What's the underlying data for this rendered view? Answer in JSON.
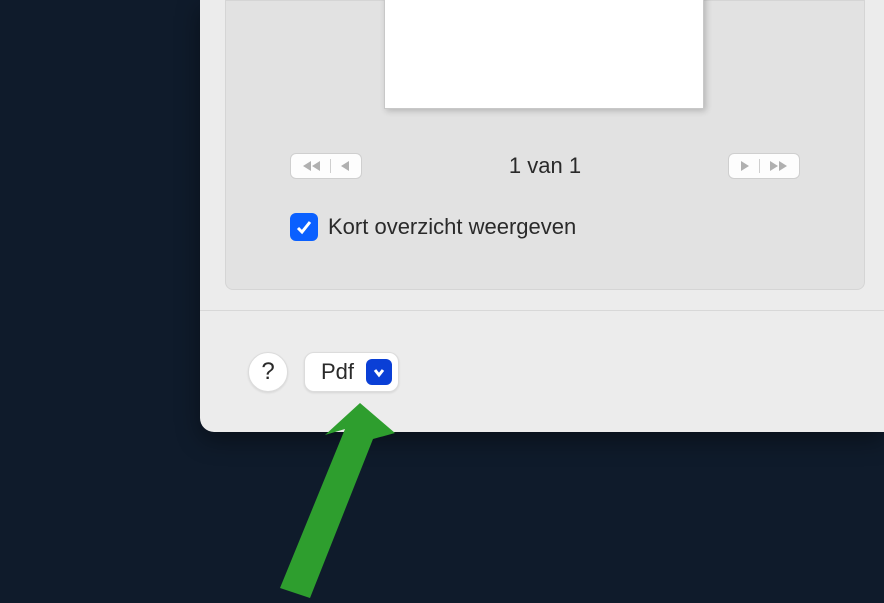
{
  "preview": {
    "page_counter": "1 van 1"
  },
  "checkbox": {
    "label": "Kort overzicht weergeven",
    "checked": true
  },
  "buttons": {
    "help_label": "?",
    "pdf_label": "Pdf"
  },
  "colors": {
    "accent": "#0a60ff",
    "chevron_bg": "#0a3fd6",
    "arrow": "#2e9e2e"
  }
}
